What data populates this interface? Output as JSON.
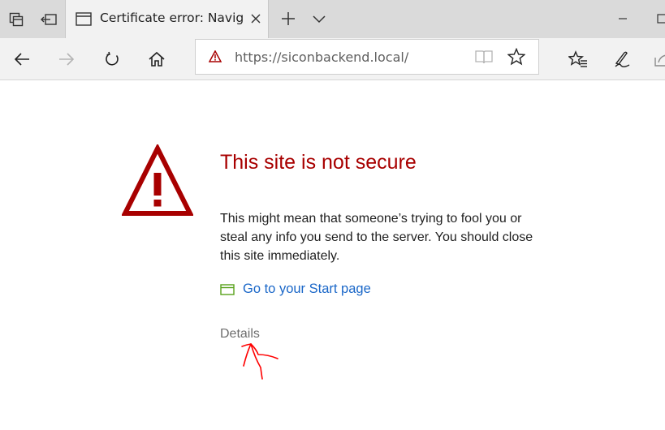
{
  "tabstrip": {
    "tab_title": "Certificate error: Naviga",
    "icons": [
      "tab-preview-icon",
      "set-aside-tabs-icon",
      "page-icon",
      "close-icon",
      "plus-icon",
      "chevron-down-icon",
      "minimize-icon",
      "maximize-icon"
    ]
  },
  "toolbar": {
    "url": "https://siconbackend.local/",
    "icons": [
      "back-arrow-icon",
      "forward-arrow-icon",
      "refresh-icon",
      "home-icon",
      "warning-icon",
      "reading-view-icon",
      "star-icon",
      "favorites-icon",
      "pen-icon",
      "share-icon"
    ]
  },
  "page": {
    "title": "This site is not secure",
    "description": "This might mean that someone’s trying to fool you or steal any info you send to the server. You should close this site immediately.",
    "start_link": "Go to your Start page",
    "details": "Details"
  },
  "colors": {
    "danger": "#a80000",
    "link": "#1a67c8",
    "start_icon": "#57a11a",
    "annotation": "#ff0000"
  }
}
